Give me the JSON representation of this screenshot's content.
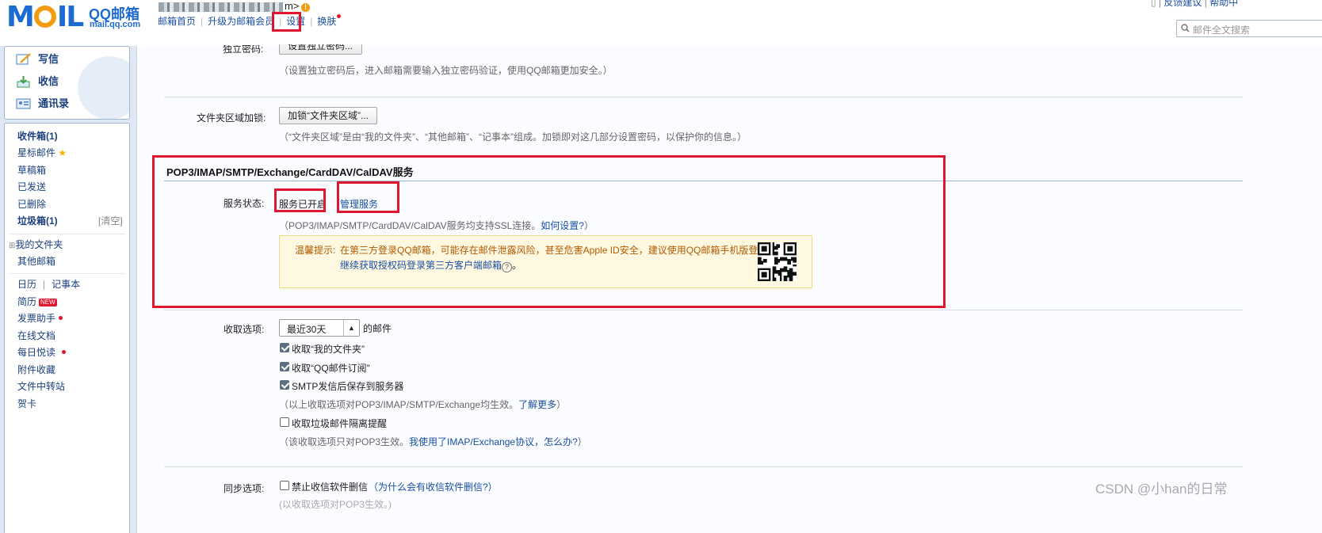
{
  "header": {
    "logo_mail": "MAIL",
    "logo_qq": "QQ邮箱",
    "logo_domain": "mail.qq.com",
    "user_suffix": "m>",
    "nav": [
      {
        "label": "邮箱首页"
      },
      {
        "label": "升级为邮箱会员"
      },
      {
        "label": "设置"
      },
      {
        "label": "换肤"
      }
    ],
    "right_links": [
      "反馈建议",
      "帮助中"
    ],
    "search_placeholder": "邮件全文搜索"
  },
  "quick_actions": [
    {
      "label": "写信",
      "icon": "write-icon"
    },
    {
      "label": "收信",
      "icon": "inbox-download-icon"
    },
    {
      "label": "通讯录",
      "icon": "contacts-icon"
    }
  ],
  "folders": {
    "inbox": "收件箱(1)",
    "starred": "星标邮件",
    "drafts": "草稿箱",
    "sent": "已发送",
    "deleted": "已删除",
    "spam": "垃圾箱(1)",
    "spam_clear": "[清空]",
    "my_folders": "我的文件夹",
    "other_mail": "其他邮箱",
    "calendar": "日历",
    "notes": "记事本",
    "resume": "简历",
    "new_tag": "NEW",
    "invoice": "发票助手",
    "online_docs": "在线文档",
    "daily_read": "每日悦读",
    "attachments": "附件收藏",
    "file_transfer": "文件中转站",
    "cards": "贺卡"
  },
  "settings": {
    "top_button": "设置独立密码...",
    "top_hint": "（设置独立密码后，进入邮箱需要输入独立密码验证，使用QQ邮箱更加安全。）",
    "folder_lock_label": "文件夹区域加锁:",
    "folder_lock_button": "加锁“文件夹区域”...",
    "folder_lock_hint": "（“文件夹区域”是由“我的文件夹”、“其他邮箱”、“记事本”组成。加锁即对这几部分设置密码，以保护你的信息。）",
    "service_title": "POP3/IMAP/SMTP/Exchange/CardDAV/CalDAV服务",
    "service_status_label": "服务状态:",
    "service_status_value": "服务已开启",
    "manage_service": "管理服务",
    "ssl_hint_prefix": "（POP3/IMAP/SMTP/CardDAV/CalDAV服务均支持SSL连接。",
    "ssl_hint_link": "如何设置?",
    "ssl_hint_suffix": "）",
    "warn_prefix": "温馨提示:",
    "warn_text": "在第三方登录QQ邮箱，可能存在邮件泄露风险，甚至危害Apple ID安全，建议使用QQ邮箱手机版登录。",
    "warn_link": "继续获取授权码登录第三方客户端邮箱",
    "warn_link_end": "。",
    "receive_label": "收取选项:",
    "receive_select": "最近30天",
    "receive_select_suffix": "的邮件",
    "opt_my_folders": "收取“我的文件夹”",
    "opt_subscriptions": "收取“QQ邮件订阅”",
    "opt_smtp_save": "SMTP发信后保存到服务器",
    "opts_hint": "（以上收取选项对POP3/IMAP/SMTP/Exchange均生效。",
    "opts_hint_link": "了解更多",
    "opts_hint_end": "）",
    "opt_spam_remind": "收取垃圾邮件隔离提醒",
    "pop3_hint": "（该收取选项只对POP3生效。",
    "pop3_hint_link": "我使用了IMAP/Exchange协议，怎么办?",
    "pop3_hint_end": "）",
    "sync_label": "同步选项:",
    "sync_opt": "禁止收信软件删信",
    "sync_hint": "（为什么会有收信软件删信?）"
  },
  "watermark": "CSDN @小han的日常",
  "colors": {
    "accent": "#1a4fa3",
    "highlight_box": "#e0152e",
    "warning_bg": "#fff8e1"
  }
}
